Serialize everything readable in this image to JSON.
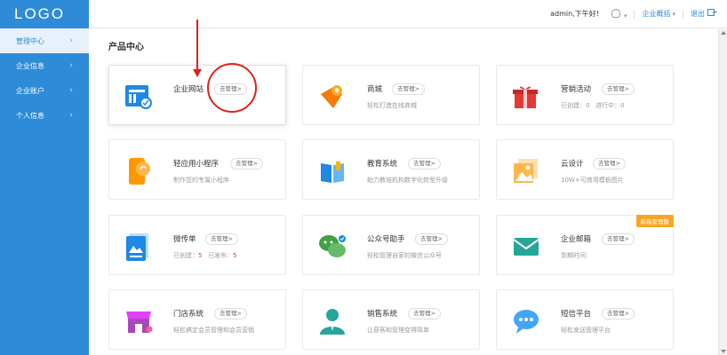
{
  "logo": "LOGO",
  "sidebar": {
    "items": [
      {
        "label": "管理中心"
      },
      {
        "label": "企业信息"
      },
      {
        "label": "企业账户"
      },
      {
        "label": "个人信息"
      }
    ]
  },
  "header": {
    "greeting": "admin,下午好!",
    "overview": "企业概括",
    "logout": "退出"
  },
  "main": {
    "title": "产品中心",
    "cards": [
      {
        "name": "企业网站",
        "button": "去管理>",
        "desc": ""
      },
      {
        "name": "商城",
        "button": "去管理>",
        "desc": "轻松打造在线商城"
      },
      {
        "name": "营销活动",
        "button": "去管理>",
        "desc_a": "已创建：0",
        "desc_b": "进行中：0"
      },
      {
        "name": "轻应用小程序",
        "button": "去管理>",
        "desc": "制作您的专属小程序"
      },
      {
        "name": "教育系统",
        "button": "去管理>",
        "desc": "助力教培机构数字化转型升级"
      },
      {
        "name": "云设计",
        "button": "去管理>",
        "desc": "10W+可商用模板图片"
      },
      {
        "name": "微传单",
        "button": "去管理>",
        "desc_a_label": "已创建：",
        "desc_a_num": "5",
        "desc_b_label": "已发布：",
        "desc_b_num": "5"
      },
      {
        "name": "公众号助手",
        "button": "去管理>",
        "desc": "轻松管理自家的微信公众号"
      },
      {
        "name": "企业邮箱",
        "button": "去管理>",
        "desc": "到期时间:",
        "tag": "邮箱管理版"
      },
      {
        "name": "门店系统",
        "button": "去管理>",
        "desc": "轻松搞定会员管理和会员营销"
      },
      {
        "name": "销售系统",
        "button": "去管理>",
        "desc": "让获客和管理变得简单"
      },
      {
        "name": "短信平台",
        "button": "去管理>",
        "desc": "轻松发送管理平台"
      }
    ]
  },
  "colors": {
    "sidebar": "#2e8bd8",
    "annotation": "#e02020",
    "tag": "#f5a623"
  }
}
